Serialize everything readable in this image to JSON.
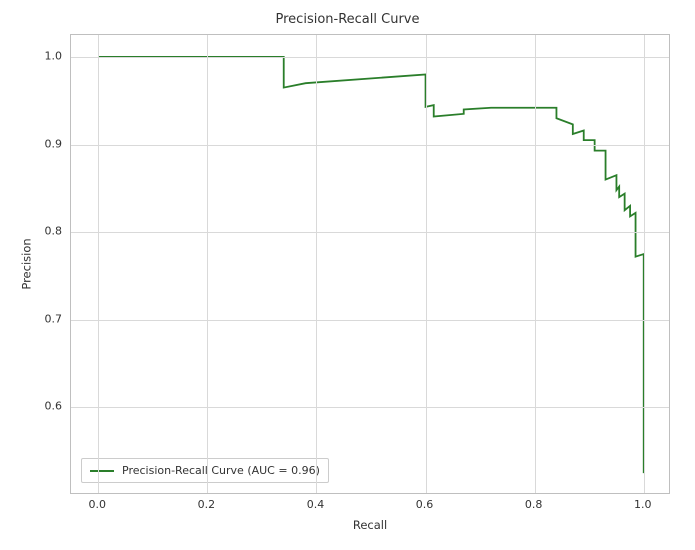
{
  "chart_data": {
    "type": "line",
    "title": "Precision-Recall Curve",
    "xlabel": "Recall",
    "ylabel": "Precision",
    "xlim": [
      -0.05,
      1.05
    ],
    "ylim": [
      0.5,
      1.025
    ],
    "x_ticks": [
      0.0,
      0.2,
      0.4,
      0.6,
      0.8,
      1.0
    ],
    "y_ticks": [
      0.6,
      0.7,
      0.8,
      0.9,
      1.0
    ],
    "color": "#2A7E2A",
    "legend_label": "Precision-Recall Curve (AUC = 0.96)",
    "auc": 0.96,
    "recall": [
      0.0,
      0.34,
      0.34,
      0.38,
      0.6,
      0.6,
      0.615,
      0.615,
      0.67,
      0.67,
      0.72,
      0.72,
      0.79,
      0.84,
      0.84,
      0.87,
      0.87,
      0.89,
      0.89,
      0.91,
      0.91,
      0.93,
      0.93,
      0.95,
      0.95,
      0.955,
      0.955,
      0.965,
      0.965,
      0.975,
      0.975,
      0.985,
      0.985,
      1.0,
      1.0,
      1.0
    ],
    "precision": [
      1.0,
      1.0,
      0.965,
      0.97,
      0.98,
      0.943,
      0.945,
      0.932,
      0.935,
      0.94,
      0.942,
      0.942,
      0.942,
      0.942,
      0.93,
      0.923,
      0.912,
      0.916,
      0.905,
      0.905,
      0.893,
      0.893,
      0.86,
      0.865,
      0.848,
      0.852,
      0.84,
      0.844,
      0.825,
      0.83,
      0.818,
      0.822,
      0.772,
      0.775,
      0.525,
      0.525
    ]
  }
}
